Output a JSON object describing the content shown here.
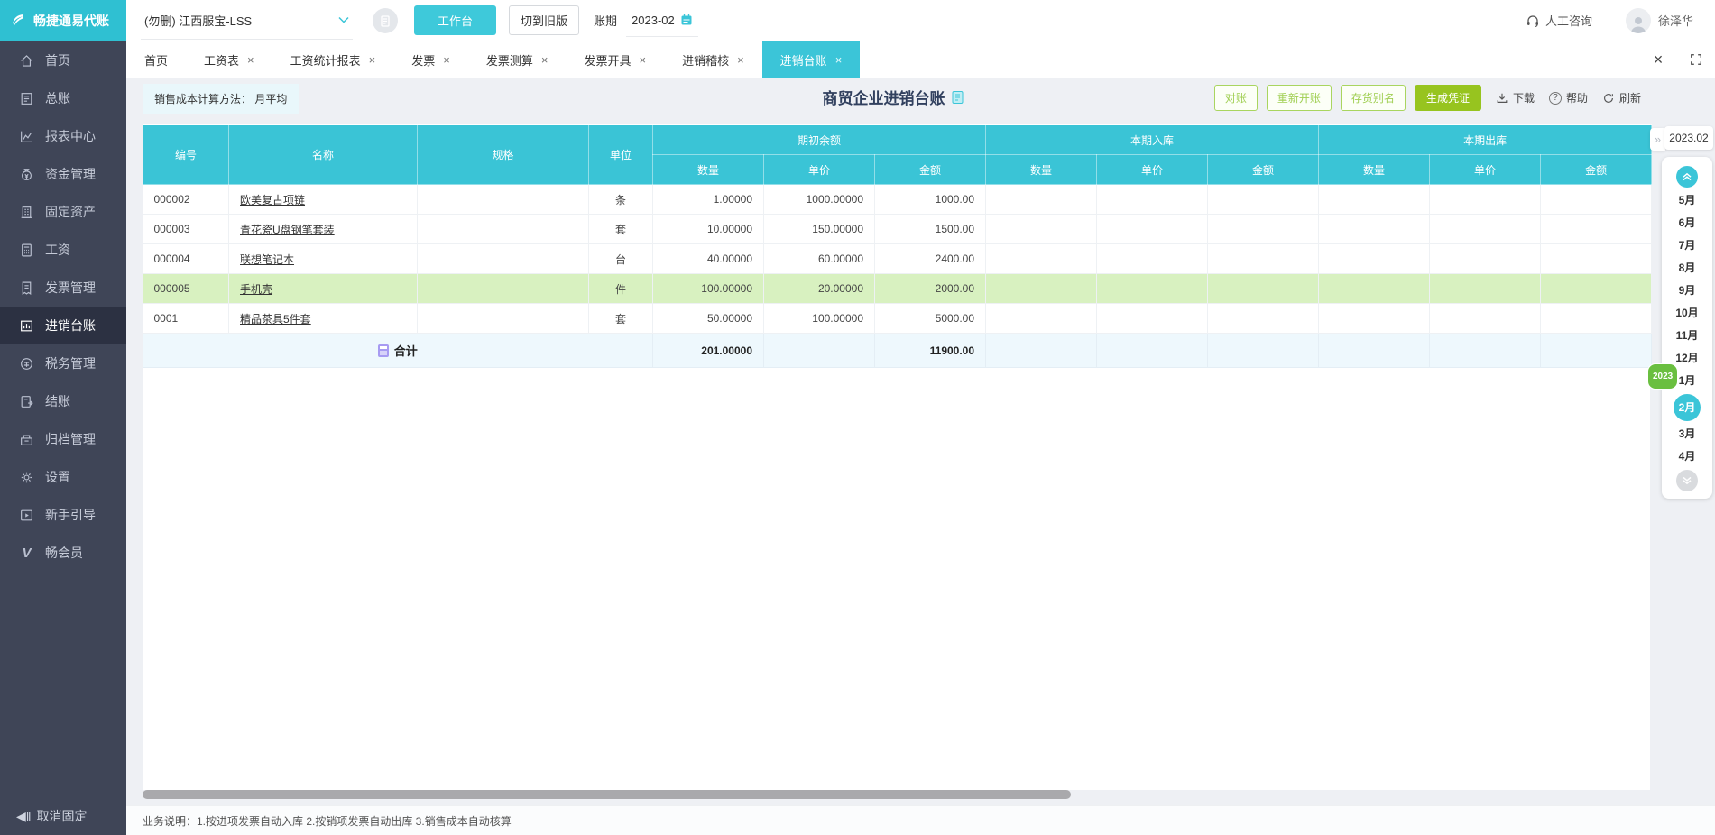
{
  "topbar": {
    "logo": "畅捷通易代账",
    "company": "(勿删) 江西服宝-LSS",
    "workbench": "工作台",
    "switch_old": "切到旧版",
    "period_label": "账期",
    "period_value": "2023-02",
    "consult": "人工咨询",
    "username": "徐泽华"
  },
  "sidebar": {
    "items": [
      {
        "label": "首页"
      },
      {
        "label": "总账"
      },
      {
        "label": "报表中心"
      },
      {
        "label": "资金管理"
      },
      {
        "label": "固定资产"
      },
      {
        "label": "工资"
      },
      {
        "label": "发票管理"
      },
      {
        "label": "进销台账"
      },
      {
        "label": "税务管理"
      },
      {
        "label": "结账"
      },
      {
        "label": "归档管理"
      },
      {
        "label": "设置"
      },
      {
        "label": "新手引导"
      },
      {
        "label": "畅会员"
      }
    ],
    "unpin": "取消固定"
  },
  "tabs": {
    "items": [
      {
        "label": "首页"
      },
      {
        "label": "工资表"
      },
      {
        "label": "工资统计报表"
      },
      {
        "label": "发票"
      },
      {
        "label": "发票测算"
      },
      {
        "label": "发票开具"
      },
      {
        "label": "进销稽核"
      },
      {
        "label": "进销台账"
      }
    ]
  },
  "toolbar": {
    "cost_method_label": "销售成本计算方法：",
    "cost_method_value": "月平均",
    "title": "商贸企业进销台账",
    "reconcile": "对账",
    "reopen": "重新开账",
    "alias": "存货别名",
    "voucher": "生成凭证",
    "download": "下载",
    "help": "帮助",
    "refresh": "刷新"
  },
  "table": {
    "col_code": "编号",
    "col_name": "名称",
    "col_spec": "规格",
    "col_unit": "单位",
    "group_opening": "期初余额",
    "group_in": "本期入库",
    "group_out": "本期出库",
    "sub": [
      "数量",
      "单价",
      "金额"
    ],
    "rows": [
      {
        "code": "000002",
        "name": "欧美复古项链",
        "spec": "",
        "unit": "条",
        "qty": "1.00000",
        "price": "1000.00000",
        "amount": "1000.00"
      },
      {
        "code": "000003",
        "name": "青花瓷U盘钢笔套装",
        "spec": "",
        "unit": "套",
        "qty": "10.00000",
        "price": "150.00000",
        "amount": "1500.00"
      },
      {
        "code": "000004",
        "name": "联想笔记本",
        "spec": "",
        "unit": "台",
        "qty": "40.00000",
        "price": "60.00000",
        "amount": "2400.00"
      },
      {
        "code": "000005",
        "name": "手机壳",
        "spec": "",
        "unit": "件",
        "qty": "100.00000",
        "price": "20.00000",
        "amount": "2000.00"
      },
      {
        "code": "0001",
        "name": "精品茶具5件套",
        "spec": "",
        "unit": "套",
        "qty": "50.00000",
        "price": "100.00000",
        "amount": "5000.00"
      }
    ],
    "total": {
      "label": "合计",
      "qty": "201.00000",
      "amount": "11900.00"
    }
  },
  "months": {
    "current": "2023.02",
    "year_badge": "2023",
    "items": [
      {
        "label": "5月"
      },
      {
        "label": "6月"
      },
      {
        "label": "7月"
      },
      {
        "label": "8月"
      },
      {
        "label": "9月"
      },
      {
        "label": "10月"
      },
      {
        "label": "11月"
      },
      {
        "label": "12月"
      },
      {
        "label": "1月"
      },
      {
        "label": "2月"
      },
      {
        "label": "3月"
      },
      {
        "label": "4月"
      }
    ]
  },
  "footer": {
    "note": "业务说明：1.按进项发票自动入库   2.按销项发票自动出库   3.销售成本自动核算"
  },
  "glyphs": {
    "close": "×",
    "collapse": "»"
  },
  "colors": {
    "brand": "#3bc5d8",
    "header": "#3ac4d6",
    "green_solid": "#97c41f",
    "green_outline": "#a9d55f",
    "highlight_row": "#d8f1c0",
    "sidebar": "#3f4557"
  }
}
